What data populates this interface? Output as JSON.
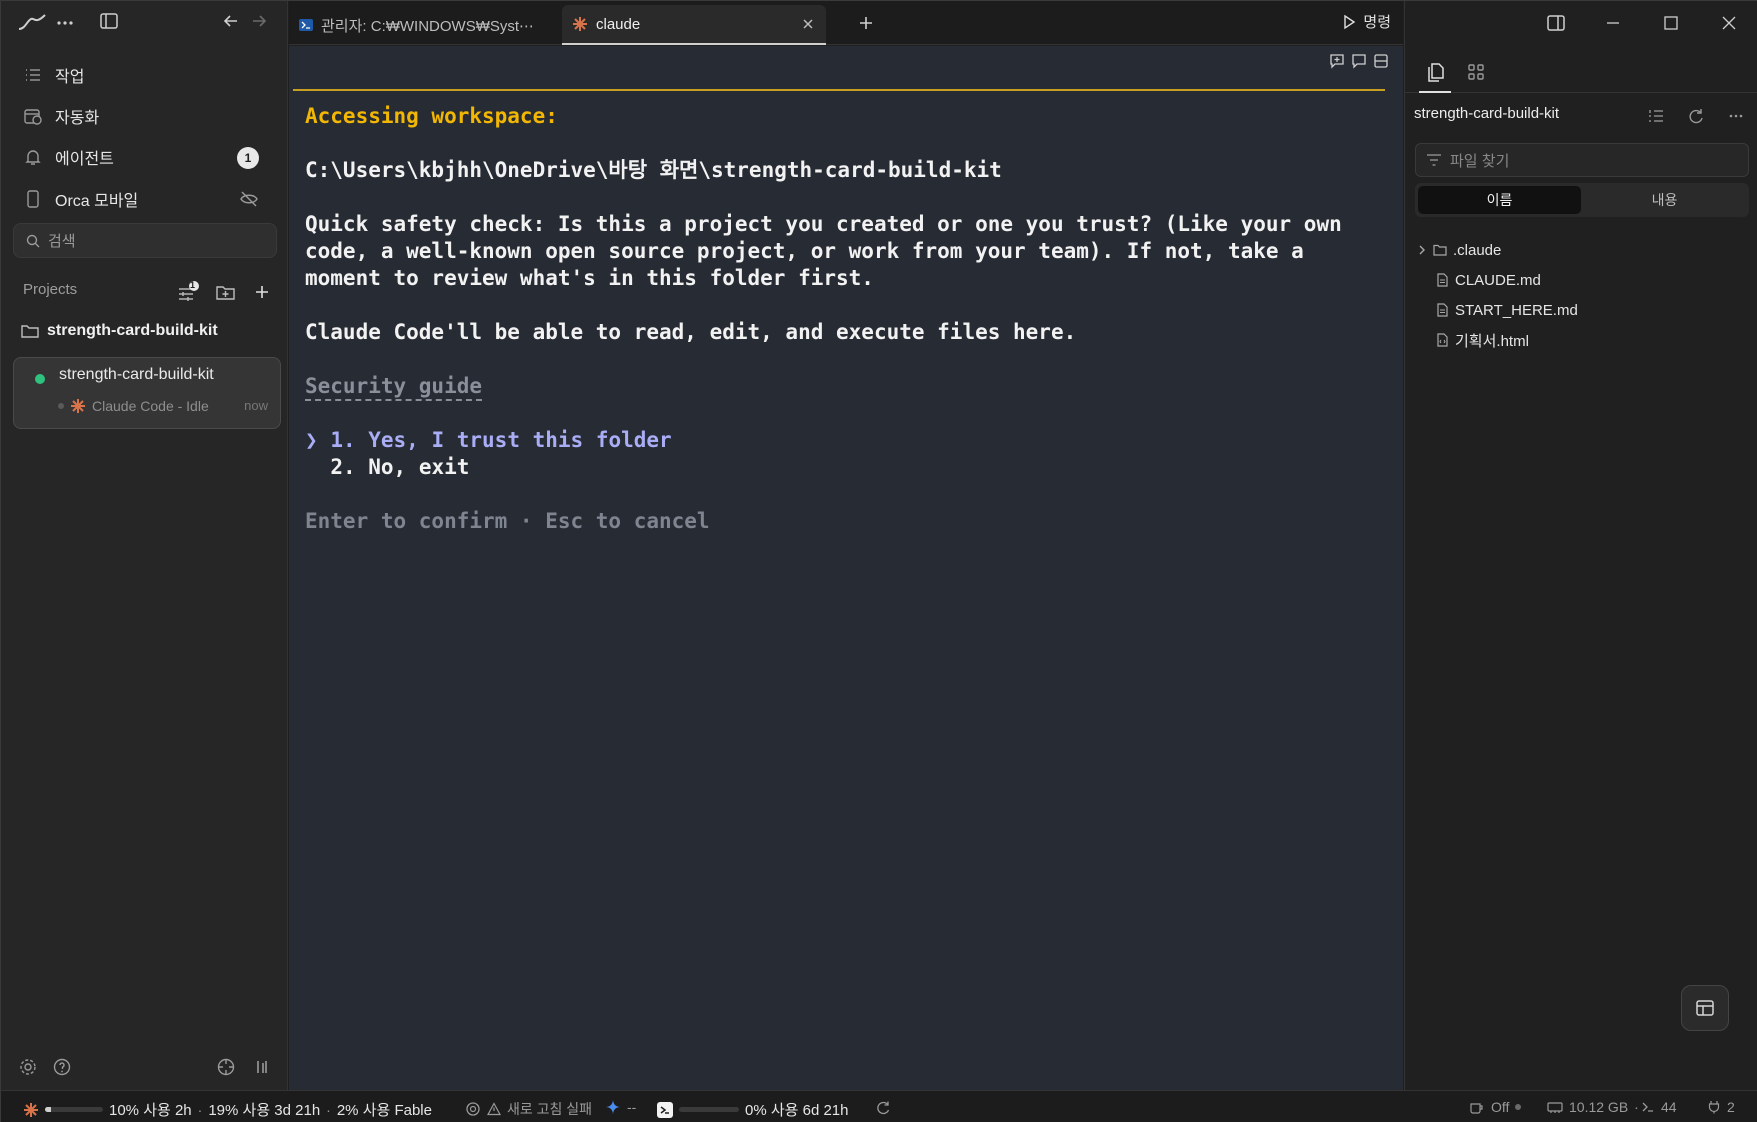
{
  "sidebar": {
    "nav": [
      {
        "label": "작업",
        "icon": "list-icon"
      },
      {
        "label": "자동화",
        "icon": "calendar-clock-icon"
      },
      {
        "label": "에이전트",
        "icon": "bell-icon",
        "badge": "1"
      },
      {
        "label": "Orca 모바일",
        "icon": "phone-icon"
      }
    ],
    "search_placeholder": "검색",
    "projects_label": "Projects",
    "filter_badge": "1",
    "project_name": "strength-card-build-kit",
    "session": {
      "title": "strength-card-build-kit",
      "subtitle": "Claude Code - Idle",
      "time": "now",
      "status_color": "#2ec27e"
    }
  },
  "tabs": [
    {
      "label": "관리자: C:₩WINDOWS₩Syst⋯",
      "icon": "powershell-icon",
      "active": false
    },
    {
      "label": "claude",
      "icon": "claude-icon",
      "active": true
    }
  ],
  "command_label": "명령",
  "terminal": {
    "heading": "Accessing workspace:",
    "path": "C:\\Users\\kbjhh\\OneDrive\\바탕 화면\\strength-card-build-kit",
    "check_lines": [
      "Quick safety check: Is this a project you created or one you trust? (Like your own",
      "code, a well-known open source project, or work from your team). If not, take a",
      "moment to review what's in this folder first."
    ],
    "permission_line": "Claude Code'll be able to read, edit, and execute files here.",
    "guide_link": "Security guide",
    "options": [
      {
        "marker": "❯",
        "text": "1. Yes, I trust this folder",
        "selected": true
      },
      {
        "marker": " ",
        "text": "2. No, exit",
        "selected": false
      }
    ],
    "hint": "Enter to confirm · Esc to cancel",
    "accent_color": "#f2b705"
  },
  "explorer": {
    "title": "strength-card-build-kit",
    "search_placeholder": "파일 찾기",
    "segments": [
      "이름",
      "내용"
    ],
    "active_segment": "이름",
    "items": [
      {
        "name": ".claude",
        "type": "folder"
      },
      {
        "name": "CLAUDE.md",
        "type": "file"
      },
      {
        "name": "START_HERE.md",
        "type": "file"
      },
      {
        "name": "기획서.html",
        "type": "file"
      }
    ]
  },
  "status": {
    "usage_1": "10% 사용 2h",
    "usage_1_fraction": 0.1,
    "sep": "·",
    "usage_2": "19% 사용 3d 21h",
    "usage_3": "2% 사용 Fable",
    "refresh_failed": "새로 고침 실패",
    "gemini_value": "--",
    "usage_4": "0% 사용 6d 21h",
    "usage_4_fraction": 0.0,
    "power": "Off",
    "memory": "10.12 GB",
    "terminals": "44",
    "ports": "2"
  }
}
